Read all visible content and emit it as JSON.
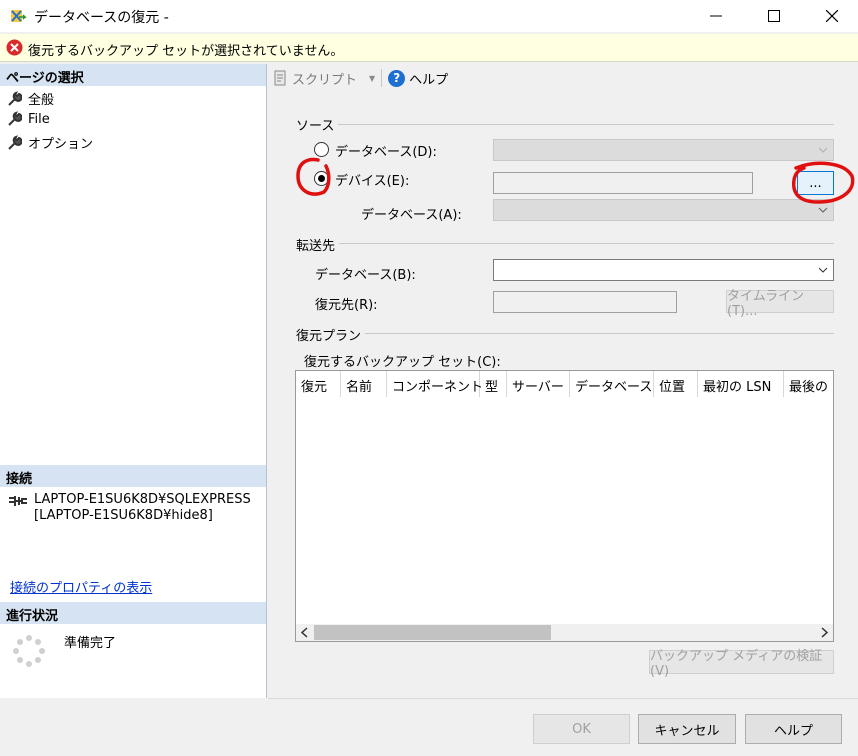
{
  "window": {
    "title": "データベースの復元 -",
    "minimize": "—",
    "maximize": "☐",
    "close": "✕"
  },
  "infobar": {
    "message": "復元するバックアップ セットが選択されていません。",
    "color": "#ffffe1"
  },
  "left": {
    "pages_header": "ページの選択",
    "pages": [
      {
        "label": "全般",
        "icon": "wrench-icon"
      },
      {
        "label": "File",
        "icon": "wrench-icon"
      },
      {
        "label": "オプション",
        "icon": "wrench-icon"
      }
    ],
    "connection_header": "接続",
    "connection_text": "LAPTOP-E1SU6K8D¥SQLEXPRESS [LAPTOP-E1SU6K8D¥hide8]",
    "connection_link": "接続のプロパティの表示",
    "progress_header": "進行状況",
    "progress_status": "準備完了"
  },
  "toolbar": {
    "script": "スクリプト",
    "help": "ヘルプ"
  },
  "source": {
    "group": "ソース",
    "radio_database": "データベース(D):",
    "radio_device": "デバイス(E):",
    "device_database_label": "データベース(A):",
    "browse_button": "...",
    "selected": "device"
  },
  "destination": {
    "group": "転送先",
    "database_label": "データベース(B):",
    "restore_to_label": "復元先(R):",
    "timeline_button": "タイムライン(T)..."
  },
  "plan": {
    "group": "復元プラン",
    "sets_label": "復元するバックアップ セット(C):",
    "columns": [
      "復元",
      "名前",
      "コンポーネント",
      "型",
      "サーバー",
      "データベース",
      "位置",
      "最初の LSN",
      "最後の"
    ],
    "rows": [],
    "verify_button": "バックアップ メディアの検証(V)"
  },
  "buttons": {
    "ok": "OK",
    "cancel": "キャンセル",
    "help": "ヘルプ"
  },
  "colors": {
    "section_header": "#d6e3f2",
    "link": "#0033cc",
    "annotation": "#e01010"
  }
}
